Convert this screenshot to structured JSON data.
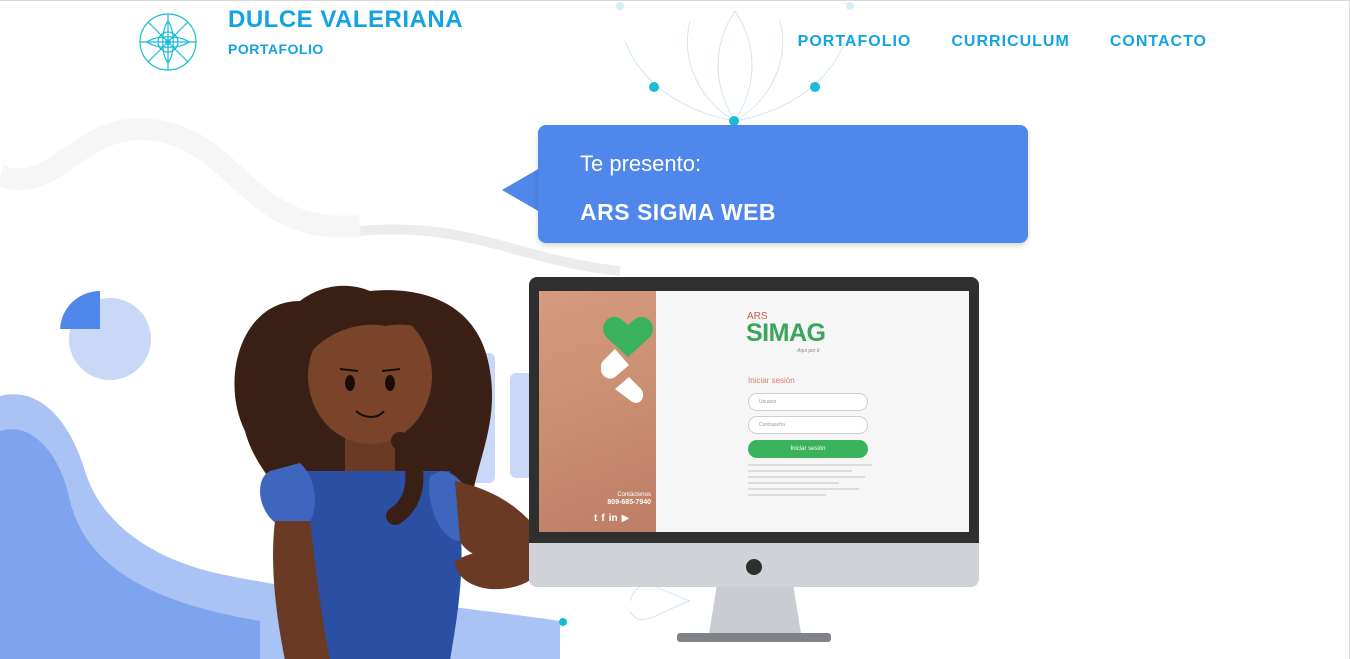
{
  "header": {
    "brand_name": "DULCE VALERIANA",
    "brand_subtitle": "PORTAFOLIO",
    "nav": [
      {
        "label": "PORTAFOLIO"
      },
      {
        "label": "CURRICULUM"
      },
      {
        "label": "CONTACTO"
      }
    ]
  },
  "hero": {
    "intro": "Te presento:",
    "project_title": "ARS SIGMA WEB"
  },
  "screen": {
    "brand_prefix": "ARS",
    "brand_name": "SIMAG",
    "tagline": "Aqui por ti",
    "login_title": "Iniciar sesión",
    "username_placeholder": "Usuario",
    "password_placeholder": "Contraseña",
    "login_button": "Iniciar sesión",
    "contact_label": "Contáctenos",
    "contact_phone": "809-685-7940"
  },
  "colors": {
    "brand": "#12a3e0",
    "bubble": "#4f87ea",
    "simag_green": "#3aa55b",
    "accent_light": "#c9d8f7"
  },
  "icons": [
    "mandala-logo-icon",
    "twitter-icon",
    "facebook-icon",
    "linkedin-icon",
    "youtube-icon",
    "heart-icon"
  ]
}
